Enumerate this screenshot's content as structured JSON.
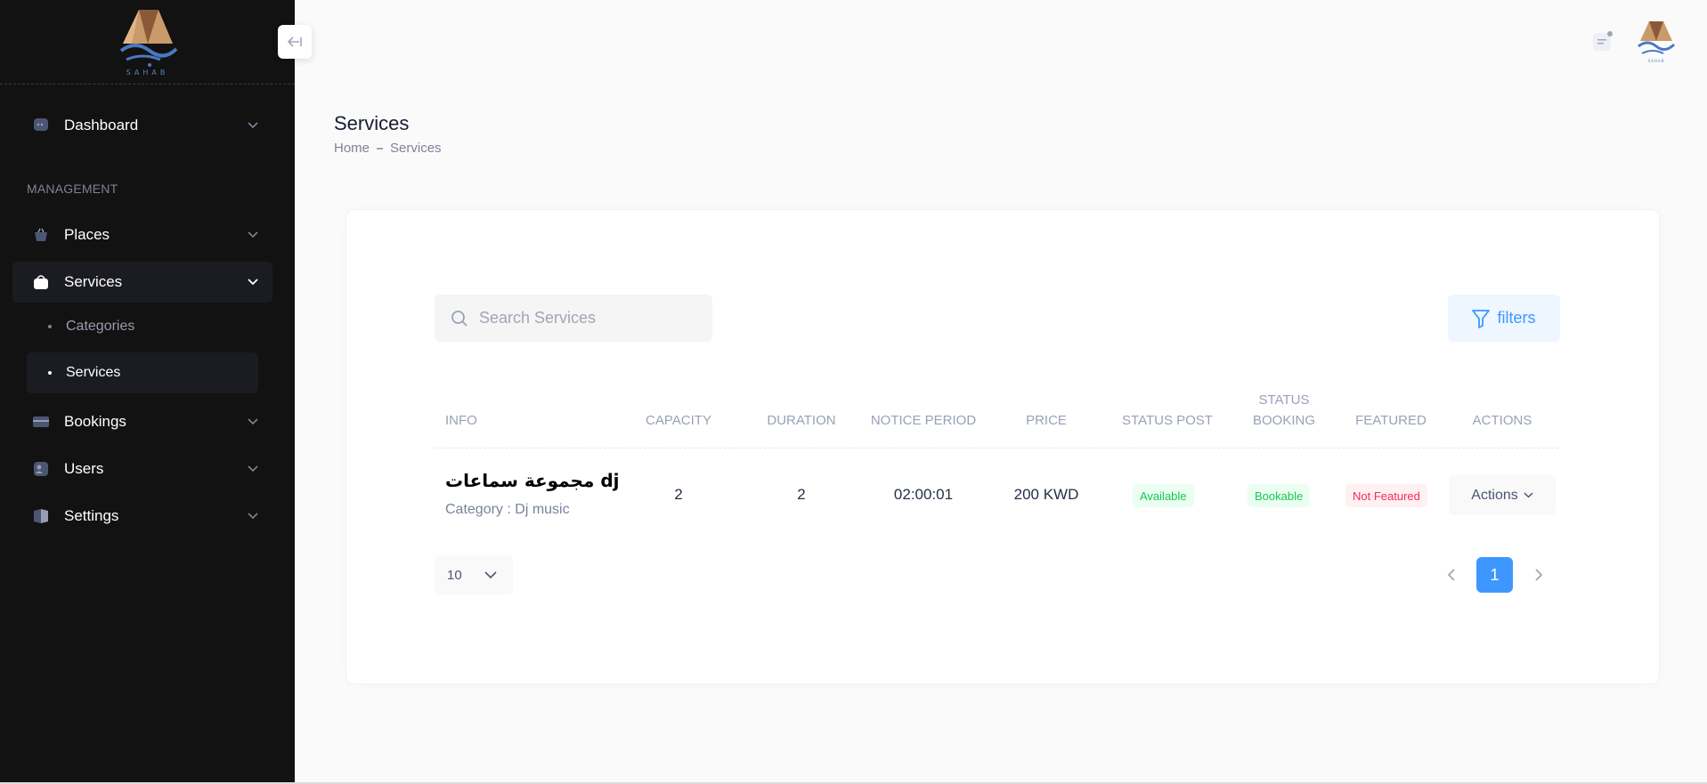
{
  "brand": {
    "logo_text": "SAHAB"
  },
  "sidebar": {
    "dashboard": "Dashboard",
    "section_label": "MANAGEMENT",
    "places": "Places",
    "services": "Services",
    "sub_categories": "Categories",
    "sub_services": "Services",
    "bookings": "Bookings",
    "users": "Users",
    "settings": "Settings"
  },
  "page": {
    "title": "Services",
    "breadcrumb_home": "Home",
    "breadcrumb_current": "Services"
  },
  "search": {
    "placeholder": "Search Services"
  },
  "filters_label": "filters",
  "table": {
    "headers": {
      "info": "INFO",
      "capacity": "CAPACITY",
      "duration": "DURATION",
      "notice_period": "NOTICE PERIOD",
      "price": "PRICE",
      "status_post": "STATUS POST",
      "status_booking_1": "STATUS",
      "status_booking_2": "BOOKING",
      "featured": "FEATURED",
      "actions": "ACTIONS"
    },
    "rows": [
      {
        "name": "مجموعة سماعات dj",
        "category": "Category : Dj music",
        "capacity": "2",
        "duration": "2",
        "notice_period": "02:00:01",
        "price": "200 KWD",
        "status_post": "Available",
        "status_booking": "Bookable",
        "featured": "Not Featured",
        "actions_label": "Actions"
      }
    ]
  },
  "pagination": {
    "page_size": "10",
    "current_page": "1"
  },
  "colors": {
    "accent": "#3e97ff",
    "sidebar_bg": "#121212",
    "success": "#17c653",
    "danger": "#f8285a"
  }
}
